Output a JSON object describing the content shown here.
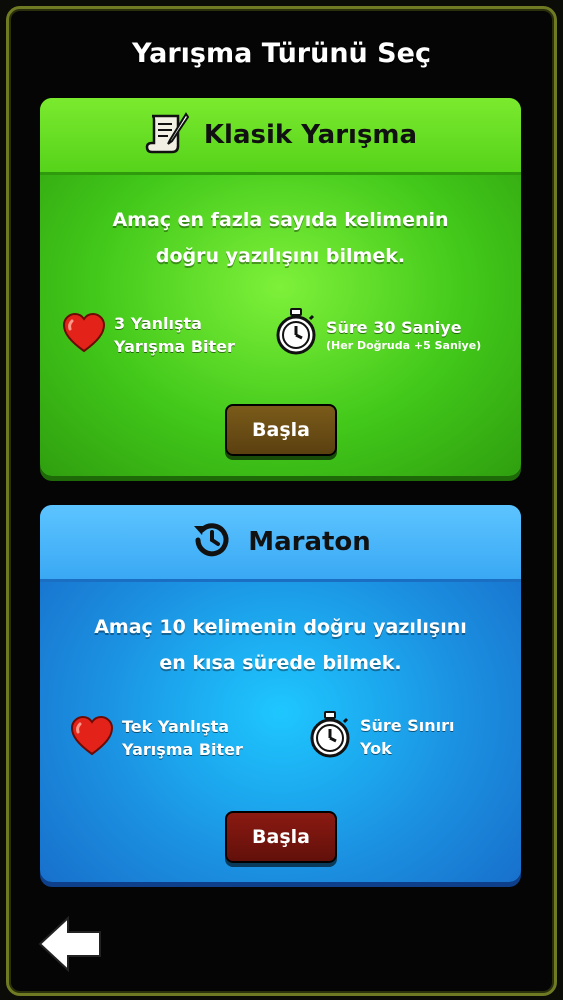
{
  "header": {
    "title": "Yarışma Türünü Seç"
  },
  "classic": {
    "title": "Klasik Yarışma",
    "icon": "scroll-quill-icon",
    "description_line1": "Amaç en fazla sayıda kelimenin",
    "description_line2": "doğru yazılışını bilmek.",
    "lives_line1": "3 Yanlışta",
    "lives_line2": "Yarışma Biter",
    "time_line1": "Süre 30 Saniye",
    "time_line2": "(Her Doğruda +5 Saniye)",
    "start_label": "Başla",
    "color": "#42c81a"
  },
  "marathon": {
    "title": "Maraton",
    "icon": "timer-restart-icon",
    "description_line1": "Amaç 10 kelimenin doğru yazılışını",
    "description_line2": "en kısa sürede bilmek.",
    "lives_line1": "Tek Yanlışta",
    "lives_line2": "Yarışma Biter",
    "time_line1": "Süre Sınırı",
    "time_line2": "Yok",
    "start_label": "Başla",
    "color": "#1b8fe0"
  },
  "footer": {
    "back_icon": "back-arrow-icon"
  }
}
